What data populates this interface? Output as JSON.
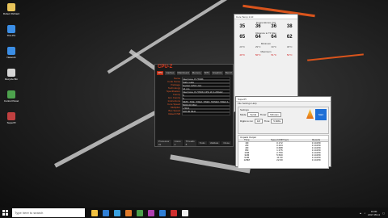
{
  "desktop": {
    "icons": [
      {
        "label": "Robert Richard",
        "color": "#e8c45a"
      },
      {
        "label": "This PC",
        "color": "#3b8ee6"
      },
      {
        "label": "Network",
        "color": "#3b8ee6"
      },
      {
        "label": "Recycle Bin",
        "color": "#d5d5d5"
      },
      {
        "label": "Control Panel",
        "color": "#4da24d"
      },
      {
        "label": "SuperPI",
        "color": "#c04040"
      }
    ]
  },
  "cpuz": {
    "title": "CPU-Z",
    "tabs": [
      "CPU",
      "Caches",
      "Mainboard",
      "Memory",
      "SPD",
      "Graphics",
      "Bench",
      "About"
    ],
    "rows": [
      {
        "k": "Name",
        "v": "Intel Core i7 7700K"
      },
      {
        "k": "Code Name",
        "v": "Kaby Lake"
      },
      {
        "k": "Package",
        "v": "Socket 1151 LGA"
      },
      {
        "k": "Technology",
        "v": "14 nm"
      },
      {
        "k": "Specification",
        "v": "Intel Core i7-7700K CPU @ 4.20GHz"
      },
      {
        "k": "Family",
        "v": "6"
      },
      {
        "k": "Ext. Family",
        "v": "6"
      },
      {
        "k": "Instructions",
        "v": "MMX, SSE, SSE2, SSE3, SSSE3, SSE4.1, SSE4.2, EM64T, VT-x, AES, AVX, AVX2"
      },
      {
        "k": "Core Speed",
        "v": "5000.00 MHz"
      },
      {
        "k": "Multiplier",
        "v": "x 50.0"
      },
      {
        "k": "Bus Speed",
        "v": "100.00 MHz"
      },
      {
        "k": "Rated FSB",
        "v": ""
      }
    ],
    "footer": {
      "selection": "Processor #1",
      "cores": "Cores 4",
      "threads": "Threads 8",
      "tools": "Tools",
      "validate": "Validate",
      "close": "Close"
    }
  },
  "temp": {
    "title": "Core Temp 1.10",
    "header": "Temperatures (°C)",
    "cores": [
      "35",
      "36",
      "36",
      "38"
    ],
    "toTj_label": "Distance to TJ Max",
    "toTj": [
      "65",
      "64",
      "64",
      "62"
    ],
    "min_label": "Minimum",
    "min": [
      "29°C",
      "29°C",
      "30°C",
      "30°C"
    ],
    "max_label": "Maximum",
    "max": [
      "49°C",
      "50°C",
      "51°C",
      "52°C"
    ],
    "buttons": [
      "Sensor Test",
      "Hide",
      "Settings",
      "Close"
    ]
  },
  "superpi": {
    "title": "SuperPI",
    "menu": "File  Settings  Help",
    "settings_label": "Settings",
    "mode_label": "Mode",
    "mode_value": "Serial",
    "timer_label": "Timer",
    "timer_value": "Minutes",
    "digits_label": "Digits to run",
    "digits_value": "1M",
    "time_label": "Time",
    "time_value": "5.828s",
    "output_label": "Unpack Output",
    "columns": [
      "Time",
      "Speed (MiP/sec)",
      "Results"
    ],
    "rows": [
      [
        "1M",
        "0.172",
        "3.14159"
      ],
      [
        "2M",
        "0.344",
        "3.14159"
      ],
      [
        "4M",
        "0.688",
        "3.14159"
      ],
      [
        "8M",
        "1.375",
        "3.14159"
      ],
      [
        "16M",
        "2.750",
        "3.14159"
      ],
      [
        "32M",
        "5.500",
        "3.14159"
      ],
      [
        "64M",
        "11.00",
        "3.14159"
      ],
      [
        "128M",
        "22.00",
        "3.14159"
      ]
    ],
    "start_label": "Start"
  },
  "taskbar": {
    "search_placeholder": "Type here to search",
    "time": "19:00",
    "date": "2017-05-11",
    "apps": [
      "#f0c040",
      "#2f7fd6",
      "#3aa1e0",
      "#e07a2a",
      "#4aa04a",
      "#b040b0",
      "#2f7fd6",
      "#d03030",
      "#f0f0f0"
    ]
  }
}
